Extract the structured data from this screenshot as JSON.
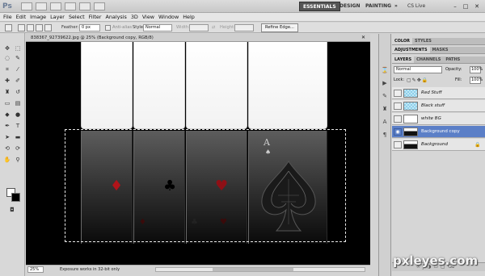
{
  "app": {
    "logo": "Ps",
    "workspaces": [
      "ESSENTIALS",
      "DESIGN",
      "PAINTING"
    ],
    "workspace_more": "»",
    "cs_live": "CS Live"
  },
  "menu": [
    "File",
    "Edit",
    "Image",
    "Layer",
    "Select",
    "Filter",
    "Analysis",
    "3D",
    "View",
    "Window",
    "Help"
  ],
  "options": {
    "feather_label": "Feather:",
    "feather_value": "0 px",
    "antialias_label": "Anti-alias",
    "style_label": "Style:",
    "style_value": "Normal",
    "width_label": "Width:",
    "height_label": "Height:",
    "refine_label": "Refine Edge..."
  },
  "document": {
    "tab_label": "838367_92739622.jpg @ 25% (Background copy, RGB/8)",
    "zoom": "25%",
    "status": "Exposure works in 32-bit only",
    "ace_letter": "A"
  },
  "panels": {
    "row1_tabs": [
      "COLOR",
      "STYLES"
    ],
    "row2_tabs": [
      "ADJUSTMENTS",
      "MASKS"
    ],
    "row3_tabs": [
      "LAYERS",
      "CHANNELS",
      "PATHS"
    ],
    "blend_mode": "Normal",
    "opacity_label": "Opacity:",
    "opacity_value": "100%",
    "lock_label": "Lock:",
    "fill_label": "Fill:",
    "fill_value": "100%",
    "layers": [
      {
        "name": "Red Stuff",
        "visible": false,
        "thumb": "checker"
      },
      {
        "name": "Black stuff",
        "visible": false,
        "thumb": "checker"
      },
      {
        "name": "white BG",
        "visible": false,
        "thumb": "white"
      },
      {
        "name": "Background copy",
        "visible": true,
        "thumb": "dark",
        "selected": true
      },
      {
        "name": "Background",
        "visible": false,
        "thumb": "dark",
        "locked": true
      }
    ]
  },
  "watermark": "pxleyes.com",
  "colors": {
    "selection": "#5b7fc7",
    "canvas": "#000000",
    "red_pip": "#b0141a"
  }
}
